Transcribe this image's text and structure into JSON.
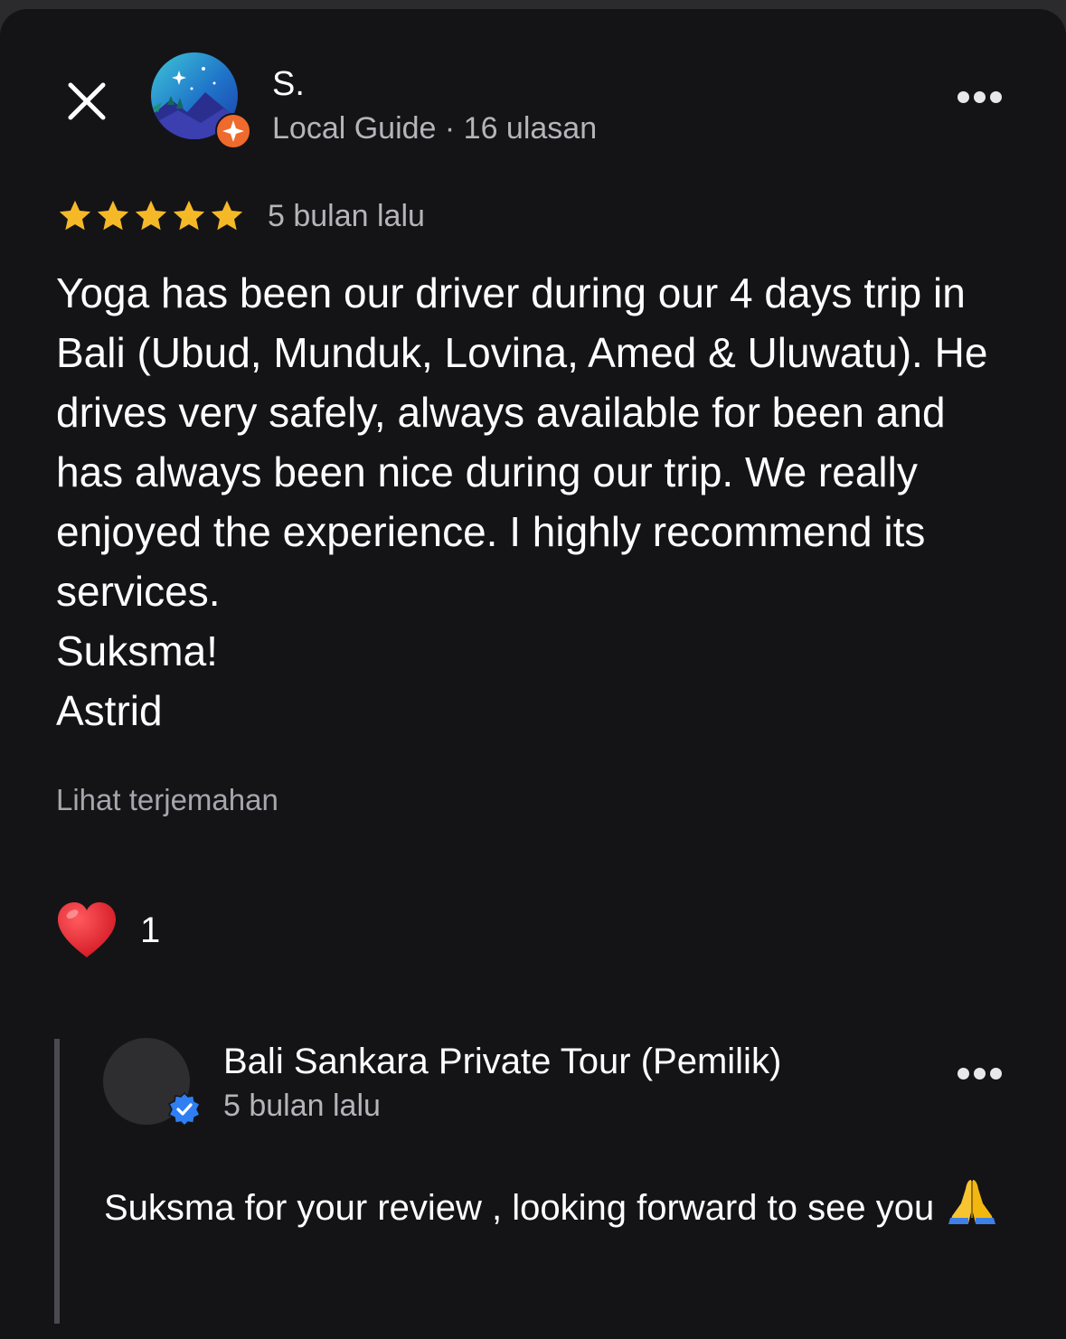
{
  "review": {
    "author_name": "S.",
    "author_meta": "Local Guide · 16 ulasan",
    "rating": 5,
    "date": "5 bulan lalu",
    "body": [
      "Yoga has been our driver during our 4 days trip in Bali (Ubud, Munduk, Lovina, Amed & Uluwatu). He drives very safely, always available for been and has always been nice during our trip. We really enjoyed the experience. I highly recommend its services.",
      "Suksma!",
      "Astrid"
    ],
    "translate_label": "Lihat terjemahan",
    "reaction_count": "1"
  },
  "owner_reply": {
    "name": "Bali Sankara Private Tour (Pemilik)",
    "date": "5 bulan lalu",
    "text": "Suksma for your review , looking forward to see you"
  },
  "icons": {
    "close": "close-icon",
    "more": "more-options-icon",
    "star": "star-icon",
    "guide_badge": "local-guide-badge-icon",
    "verified": "verified-badge-icon",
    "reaction": "heart-icon",
    "pray": "folded-hands-emoji-icon"
  },
  "colors": {
    "background": "#141417",
    "star": "#f5b928",
    "guide_badge": "#ee6a2d",
    "verified": "#2f7ff2",
    "heart": "#e0232e",
    "muted_text": "#b4b4ba"
  }
}
